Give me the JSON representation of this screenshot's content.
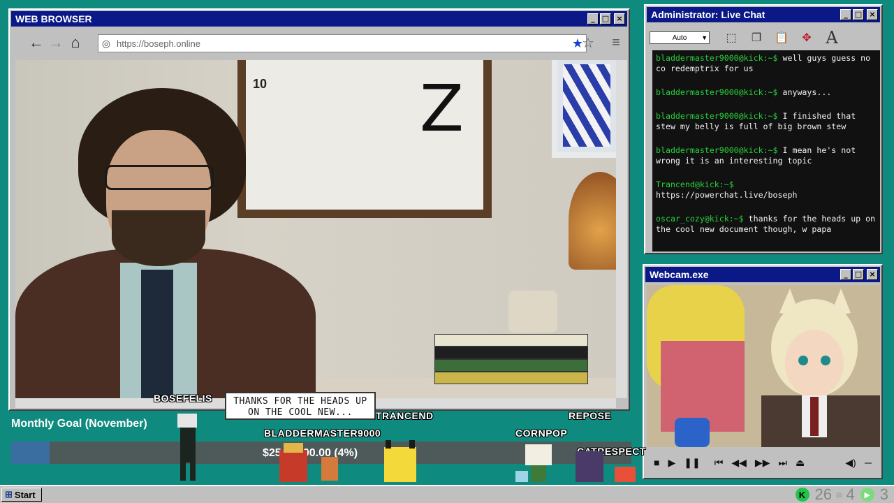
{
  "browser": {
    "title": "WEB BROWSER",
    "url": "https://boseph.online",
    "window_buttons": [
      "_",
      "□",
      "×"
    ]
  },
  "video_scene": {
    "frame_number": "10"
  },
  "chat": {
    "title": "Administrator: Live Chat",
    "font_select": "Auto",
    "font_icon": "A",
    "messages": [
      {
        "user": "bladdermaster9000@kick:~$",
        "text": "well guys guess no co redemptrix for us"
      },
      {
        "user": "bladdermaster9000@kick:~$",
        "text": "anyways..."
      },
      {
        "user": "bladdermaster9000@kick:~$",
        "text": "I finished that stew my belly is full of big brown stew"
      },
      {
        "user": "bladdermaster9000@kick:~$",
        "text": "I mean he's not wrong it is an interesting topic"
      },
      {
        "user": "Trancend@kick:~$",
        "text": "https://powerchat.live/boseph"
      },
      {
        "user": "oscar_cozy@kick:~$",
        "text": "thanks for the heads up on the cool new document though, w papa"
      }
    ]
  },
  "webcam": {
    "title": "Webcam.exe"
  },
  "goal": {
    "title": "Monthly Goal (November)",
    "amount_text": "$25 / $700.00 (4%)",
    "progress_fraction": 0.04
  },
  "players": {
    "names": [
      "BOSEFELIS",
      "BLADDERMASTER9000",
      "TRANCEND",
      "CORNPOP",
      "REPOSE",
      "CATRESPECT"
    ],
    "bubble": "THANKS FOR THE HEADS UP ON THE COOL NEW..."
  },
  "taskbar": {
    "start": "Start",
    "tray_k": "K",
    "count_a": "26",
    "count_b": "4",
    "count_c": "3"
  },
  "colors": {
    "desktop": "#0f8a7e",
    "titlebar": "#0a1888",
    "chat_user": "#27d13c",
    "goal_fill": "#3b6ea0"
  }
}
